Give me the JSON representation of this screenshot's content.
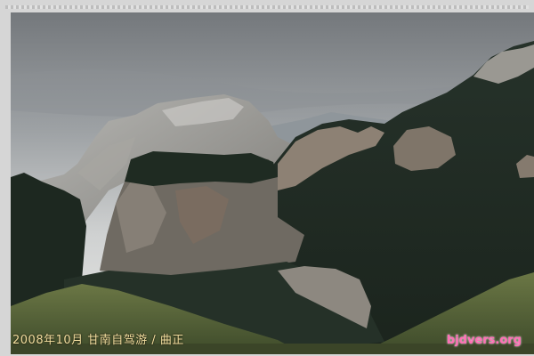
{
  "caption": "2008年10月 甘南自驾游 / 曲正",
  "watermark": "bjdvers.org",
  "palette": {
    "sky_top": "#7d8185",
    "sky_mid": "#b7babc",
    "sky_low": "#e5e5e3",
    "far_rock": "#9b9d9f",
    "rock_mid": "#8a8277",
    "forest_dark": "#1f2a22",
    "forest_mid": "#2e3a2f",
    "meadow": "#63703e"
  }
}
